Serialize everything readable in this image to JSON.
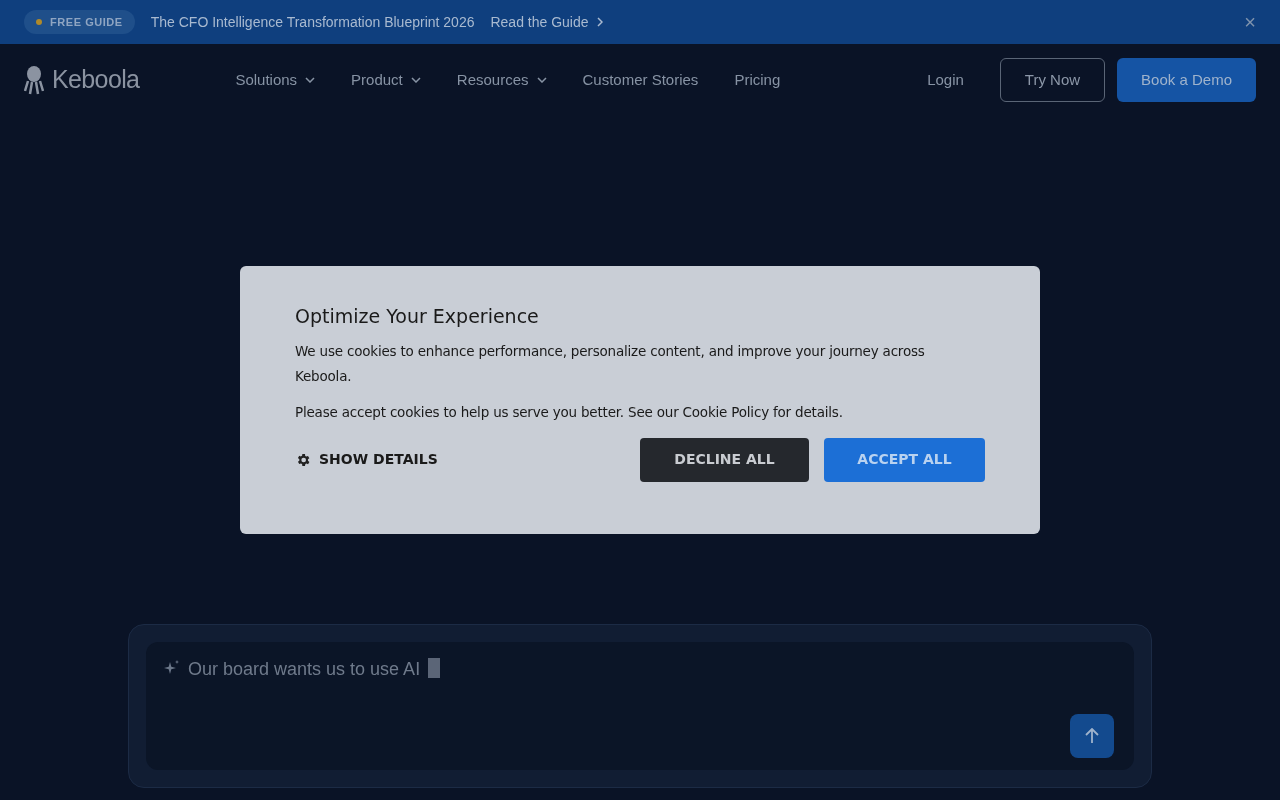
{
  "banner": {
    "badge": "FREE GUIDE",
    "text": "The CFO Intelligence Transformation Blueprint 2026",
    "link": "Read the Guide",
    "close": "×"
  },
  "nav": {
    "logo": "Keboola",
    "items": [
      {
        "label": "Solutions",
        "dropdown": true
      },
      {
        "label": "Product",
        "dropdown": true
      },
      {
        "label": "Resources",
        "dropdown": true
      },
      {
        "label": "Customer Stories",
        "dropdown": false
      },
      {
        "label": "Pricing",
        "dropdown": false
      }
    ],
    "login": "Login",
    "try": "Try Now",
    "demo": "Book a Demo"
  },
  "chat": {
    "value": "Our board wants us to use AI"
  },
  "cookie_dialog": {
    "title": "Optimize Your Experience",
    "text1": "We use cookies to enhance performance, personalize content, and improve your journey across Keboola.",
    "text2": "Please accept cookies to help us serve you better. See our Cookie Policy for details.",
    "details": "SHOW DETAILS",
    "decline": "DECLINE ALL",
    "accept": "ACCEPT ALL"
  }
}
